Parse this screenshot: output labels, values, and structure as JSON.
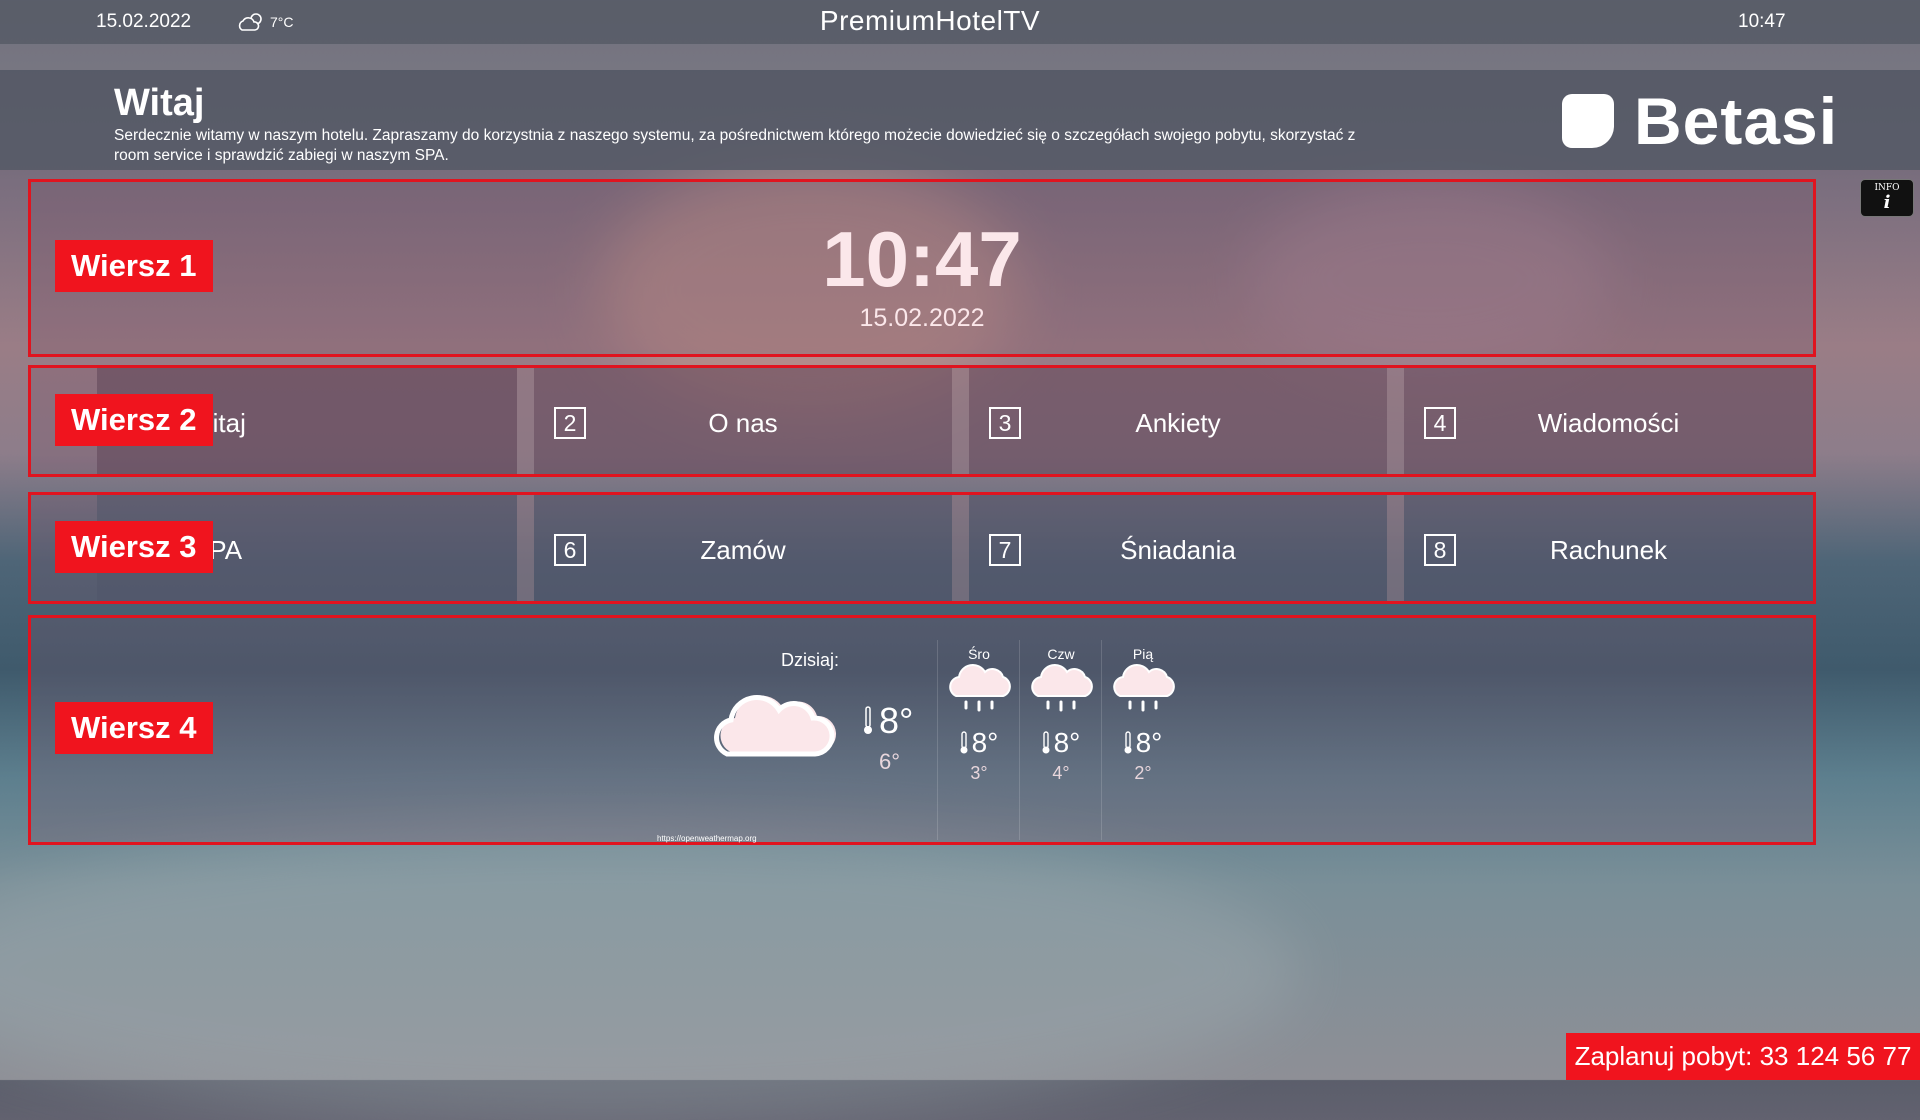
{
  "topbar": {
    "date": "15.02.2022",
    "weather_temp": "7°C",
    "weather_icon": "cloud-sun-icon",
    "title": "PremiumHotelTV",
    "time": "10:47"
  },
  "header": {
    "title": "Witaj",
    "text": "Serdecznie witamy w naszym hotelu. Zapraszamy do korzystnia z naszego systemu, za pośrednictwem którego możecie dowiedzieć się o szczegółach swojego pobytu, skorzystać z room service i sprawdzić zabiegi w naszym SPA.",
    "logo_text": "Betasi"
  },
  "info_button": {
    "label": "INFO",
    "icon": "i"
  },
  "rows": {
    "row1": {
      "label": "Wiersz 1",
      "clock": "10:47",
      "date": "15.02.2022"
    },
    "row2": {
      "label": "Wiersz 2",
      "items": [
        {
          "num": "",
          "label": "Witaj"
        },
        {
          "num": "2",
          "label": "O nas"
        },
        {
          "num": "3",
          "label": "Ankiety"
        },
        {
          "num": "4",
          "label": "Wiadomości"
        }
      ]
    },
    "row3": {
      "label": "Wiersz 3",
      "items": [
        {
          "num": "",
          "label": "SPA"
        },
        {
          "num": "6",
          "label": "Zamów"
        },
        {
          "num": "7",
          "label": "Śniadania"
        },
        {
          "num": "8",
          "label": "Rachunek"
        }
      ]
    },
    "row4": {
      "label": "Wiersz 4"
    }
  },
  "weather": {
    "today_label": "Dzisiaj:",
    "today_icon": "cloud-icon",
    "today_max": "8°",
    "today_min": "6°",
    "days": [
      {
        "name": "Śro",
        "icon": "cloud-rain-icon",
        "max": "8°",
        "min": "3°"
      },
      {
        "name": "Czw",
        "icon": "cloud-rain-icon",
        "max": "8°",
        "min": "4°"
      },
      {
        "name": "Pią",
        "icon": "cloud-rain-icon",
        "max": "8°",
        "min": "2°"
      }
    ],
    "source": "https://openweathermap.org"
  },
  "promo": "Zaplanuj pobyt: 33 124 56 77",
  "colors": {
    "accent": "#f0141e",
    "bar": "#5a5e69"
  }
}
